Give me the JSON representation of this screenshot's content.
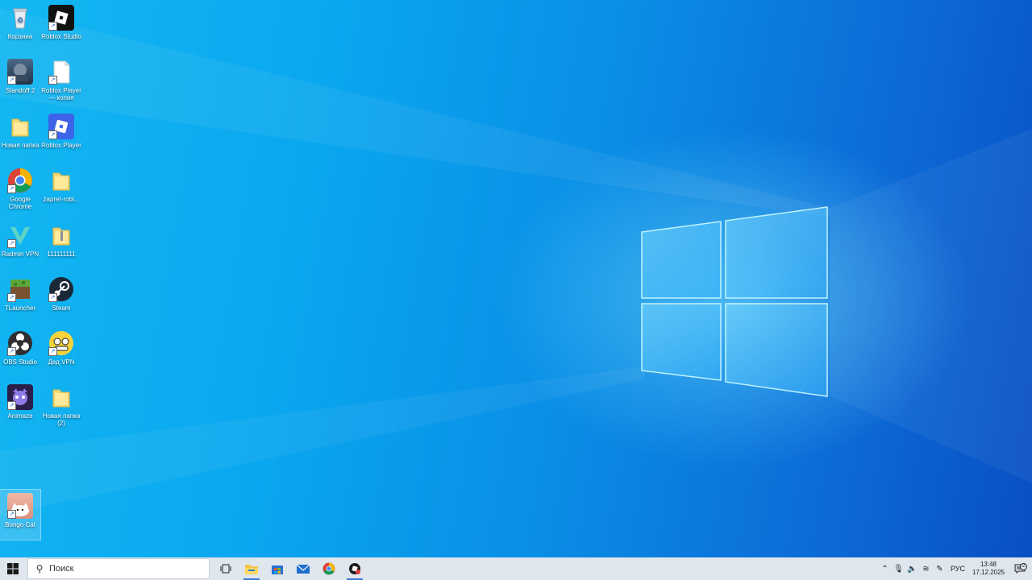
{
  "desktop": {
    "icons": [
      {
        "label": "Корзина",
        "icon": "recycle-bin-icon"
      },
      {
        "label": "Roblox Studio",
        "icon": "roblox-studio-icon"
      },
      {
        "label": "Standoff 2",
        "icon": "standoff2-icon"
      },
      {
        "label": "Roblox Player — копия",
        "icon": "document-icon"
      },
      {
        "label": "Новая папка",
        "icon": "folder-icon"
      },
      {
        "label": "Roblox Player",
        "icon": "roblox-player-icon"
      },
      {
        "label": "Google Chrome",
        "icon": "chrome-icon"
      },
      {
        "label": "zapret-robl...",
        "icon": "folder-icon"
      },
      {
        "label": "Radmin VPN",
        "icon": "radmin-vpn-icon"
      },
      {
        "label": "111111111",
        "icon": "zip-folder-icon"
      },
      {
        "label": "TLauncher",
        "icon": "minecraft-icon"
      },
      {
        "label": "Steam",
        "icon": "steam-icon"
      },
      {
        "label": "OBS Studio",
        "icon": "obs-icon"
      },
      {
        "label": "Дед VPN",
        "icon": "ded-vpn-icon"
      },
      {
        "label": "Animaze",
        "icon": "animaze-icon"
      },
      {
        "label": "Новая папка (2)",
        "icon": "folder-icon"
      },
      {
        "label": "Bongo Cat",
        "icon": "bongo-cat-icon"
      }
    ]
  },
  "taskbar": {
    "search_placeholder": "Поиск",
    "pinned": [
      "task-view-icon",
      "file-explorer-icon",
      "microsoft-store-icon",
      "mail-icon",
      "chrome-icon",
      "roblox-icon"
    ],
    "tray": {
      "language": "РУС",
      "time": "13:48",
      "date": "17.12.2025",
      "notification_count": "2"
    }
  },
  "colors": {
    "taskbar_bg": "#dfe6ee",
    "desktop_accent": "#0a8fe6",
    "active_indicator": "#3a7bd5"
  }
}
